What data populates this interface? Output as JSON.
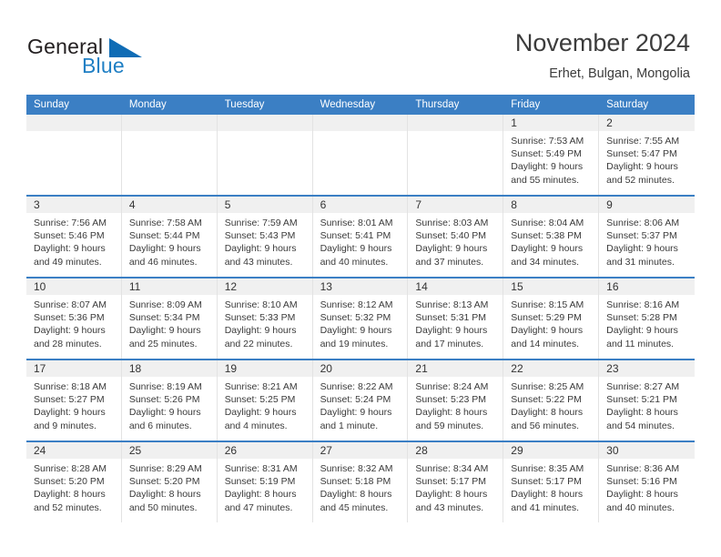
{
  "brand": {
    "name_part1": "General",
    "name_part2": "Blue",
    "triangle_color": "#0f6cb5",
    "blue_color": "#1f7fc4"
  },
  "header": {
    "title": "November 2024",
    "location": "Erhet, Bulgan, Mongolia"
  },
  "theme": {
    "header_blue": "#3b7fc4",
    "day_band_gray": "#f0f0f0",
    "grid_line": "#e3e3e3"
  },
  "weekdays": [
    "Sunday",
    "Monday",
    "Tuesday",
    "Wednesday",
    "Thursday",
    "Friday",
    "Saturday"
  ],
  "weeks": [
    [
      {
        "day": "",
        "empty": true
      },
      {
        "day": "",
        "empty": true
      },
      {
        "day": "",
        "empty": true
      },
      {
        "day": "",
        "empty": true
      },
      {
        "day": "",
        "empty": true
      },
      {
        "day": "1",
        "sunrise": "Sunrise: 7:53 AM",
        "sunset": "Sunset: 5:49 PM",
        "daylight_line1": "Daylight: 9 hours",
        "daylight_line2": "and 55 minutes."
      },
      {
        "day": "2",
        "sunrise": "Sunrise: 7:55 AM",
        "sunset": "Sunset: 5:47 PM",
        "daylight_line1": "Daylight: 9 hours",
        "daylight_line2": "and 52 minutes."
      }
    ],
    [
      {
        "day": "3",
        "sunrise": "Sunrise: 7:56 AM",
        "sunset": "Sunset: 5:46 PM",
        "daylight_line1": "Daylight: 9 hours",
        "daylight_line2": "and 49 minutes."
      },
      {
        "day": "4",
        "sunrise": "Sunrise: 7:58 AM",
        "sunset": "Sunset: 5:44 PM",
        "daylight_line1": "Daylight: 9 hours",
        "daylight_line2": "and 46 minutes."
      },
      {
        "day": "5",
        "sunrise": "Sunrise: 7:59 AM",
        "sunset": "Sunset: 5:43 PM",
        "daylight_line1": "Daylight: 9 hours",
        "daylight_line2": "and 43 minutes."
      },
      {
        "day": "6",
        "sunrise": "Sunrise: 8:01 AM",
        "sunset": "Sunset: 5:41 PM",
        "daylight_line1": "Daylight: 9 hours",
        "daylight_line2": "and 40 minutes."
      },
      {
        "day": "7",
        "sunrise": "Sunrise: 8:03 AM",
        "sunset": "Sunset: 5:40 PM",
        "daylight_line1": "Daylight: 9 hours",
        "daylight_line2": "and 37 minutes."
      },
      {
        "day": "8",
        "sunrise": "Sunrise: 8:04 AM",
        "sunset": "Sunset: 5:38 PM",
        "daylight_line1": "Daylight: 9 hours",
        "daylight_line2": "and 34 minutes."
      },
      {
        "day": "9",
        "sunrise": "Sunrise: 8:06 AM",
        "sunset": "Sunset: 5:37 PM",
        "daylight_line1": "Daylight: 9 hours",
        "daylight_line2": "and 31 minutes."
      }
    ],
    [
      {
        "day": "10",
        "sunrise": "Sunrise: 8:07 AM",
        "sunset": "Sunset: 5:36 PM",
        "daylight_line1": "Daylight: 9 hours",
        "daylight_line2": "and 28 minutes."
      },
      {
        "day": "11",
        "sunrise": "Sunrise: 8:09 AM",
        "sunset": "Sunset: 5:34 PM",
        "daylight_line1": "Daylight: 9 hours",
        "daylight_line2": "and 25 minutes."
      },
      {
        "day": "12",
        "sunrise": "Sunrise: 8:10 AM",
        "sunset": "Sunset: 5:33 PM",
        "daylight_line1": "Daylight: 9 hours",
        "daylight_line2": "and 22 minutes."
      },
      {
        "day": "13",
        "sunrise": "Sunrise: 8:12 AM",
        "sunset": "Sunset: 5:32 PM",
        "daylight_line1": "Daylight: 9 hours",
        "daylight_line2": "and 19 minutes."
      },
      {
        "day": "14",
        "sunrise": "Sunrise: 8:13 AM",
        "sunset": "Sunset: 5:31 PM",
        "daylight_line1": "Daylight: 9 hours",
        "daylight_line2": "and 17 minutes."
      },
      {
        "day": "15",
        "sunrise": "Sunrise: 8:15 AM",
        "sunset": "Sunset: 5:29 PM",
        "daylight_line1": "Daylight: 9 hours",
        "daylight_line2": "and 14 minutes."
      },
      {
        "day": "16",
        "sunrise": "Sunrise: 8:16 AM",
        "sunset": "Sunset: 5:28 PM",
        "daylight_line1": "Daylight: 9 hours",
        "daylight_line2": "and 11 minutes."
      }
    ],
    [
      {
        "day": "17",
        "sunrise": "Sunrise: 8:18 AM",
        "sunset": "Sunset: 5:27 PM",
        "daylight_line1": "Daylight: 9 hours",
        "daylight_line2": "and 9 minutes."
      },
      {
        "day": "18",
        "sunrise": "Sunrise: 8:19 AM",
        "sunset": "Sunset: 5:26 PM",
        "daylight_line1": "Daylight: 9 hours",
        "daylight_line2": "and 6 minutes."
      },
      {
        "day": "19",
        "sunrise": "Sunrise: 8:21 AM",
        "sunset": "Sunset: 5:25 PM",
        "daylight_line1": "Daylight: 9 hours",
        "daylight_line2": "and 4 minutes."
      },
      {
        "day": "20",
        "sunrise": "Sunrise: 8:22 AM",
        "sunset": "Sunset: 5:24 PM",
        "daylight_line1": "Daylight: 9 hours",
        "daylight_line2": "and 1 minute."
      },
      {
        "day": "21",
        "sunrise": "Sunrise: 8:24 AM",
        "sunset": "Sunset: 5:23 PM",
        "daylight_line1": "Daylight: 8 hours",
        "daylight_line2": "and 59 minutes."
      },
      {
        "day": "22",
        "sunrise": "Sunrise: 8:25 AM",
        "sunset": "Sunset: 5:22 PM",
        "daylight_line1": "Daylight: 8 hours",
        "daylight_line2": "and 56 minutes."
      },
      {
        "day": "23",
        "sunrise": "Sunrise: 8:27 AM",
        "sunset": "Sunset: 5:21 PM",
        "daylight_line1": "Daylight: 8 hours",
        "daylight_line2": "and 54 minutes."
      }
    ],
    [
      {
        "day": "24",
        "sunrise": "Sunrise: 8:28 AM",
        "sunset": "Sunset: 5:20 PM",
        "daylight_line1": "Daylight: 8 hours",
        "daylight_line2": "and 52 minutes."
      },
      {
        "day": "25",
        "sunrise": "Sunrise: 8:29 AM",
        "sunset": "Sunset: 5:20 PM",
        "daylight_line1": "Daylight: 8 hours",
        "daylight_line2": "and 50 minutes."
      },
      {
        "day": "26",
        "sunrise": "Sunrise: 8:31 AM",
        "sunset": "Sunset: 5:19 PM",
        "daylight_line1": "Daylight: 8 hours",
        "daylight_line2": "and 47 minutes."
      },
      {
        "day": "27",
        "sunrise": "Sunrise: 8:32 AM",
        "sunset": "Sunset: 5:18 PM",
        "daylight_line1": "Daylight: 8 hours",
        "daylight_line2": "and 45 minutes."
      },
      {
        "day": "28",
        "sunrise": "Sunrise: 8:34 AM",
        "sunset": "Sunset: 5:17 PM",
        "daylight_line1": "Daylight: 8 hours",
        "daylight_line2": "and 43 minutes."
      },
      {
        "day": "29",
        "sunrise": "Sunrise: 8:35 AM",
        "sunset": "Sunset: 5:17 PM",
        "daylight_line1": "Daylight: 8 hours",
        "daylight_line2": "and 41 minutes."
      },
      {
        "day": "30",
        "sunrise": "Sunrise: 8:36 AM",
        "sunset": "Sunset: 5:16 PM",
        "daylight_line1": "Daylight: 8 hours",
        "daylight_line2": "and 40 minutes."
      }
    ]
  ]
}
